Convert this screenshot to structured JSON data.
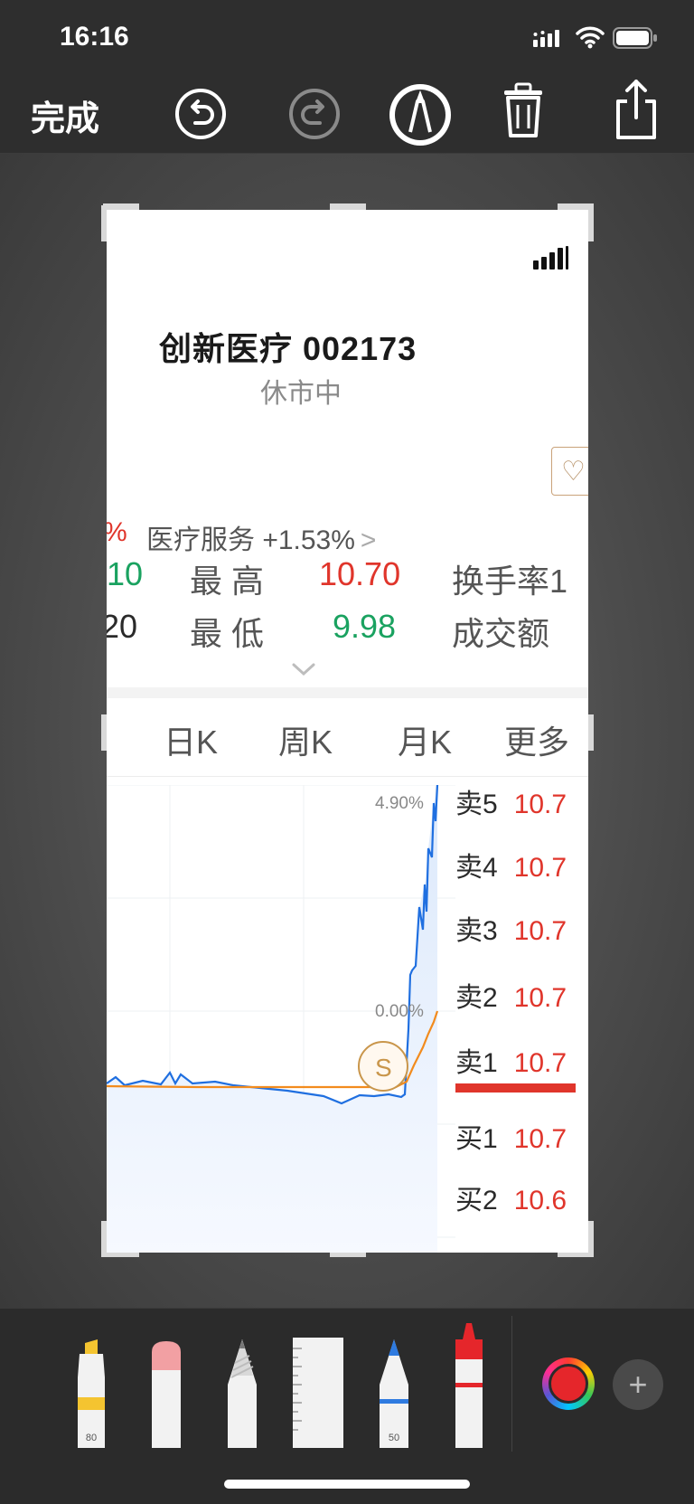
{
  "status_bar": {
    "time": "16:16"
  },
  "toolbar": {
    "done_label": "完成",
    "undo_icon": "undo-icon",
    "redo_icon": "redo-icon",
    "markup_icon": "markup-pen-icon",
    "delete_icon": "trash-icon",
    "share_icon": "share-icon"
  },
  "screenshot": {
    "stock_name_code": "创新医疗  002173",
    "market_status": "休市中",
    "change_fragment": "%",
    "sector": "医疗服务 +1.53%",
    "sector_chevron": ">",
    "quote": {
      "left_val_1": "10",
      "left_val_2": "20",
      "high_label": "最  高",
      "high_value": "10.70",
      "low_label": "最  低",
      "low_value": "9.98",
      "turnover_label": "换手率",
      "turnover_frag": "1",
      "amount_label": "成交额"
    },
    "tabs": [
      "日K",
      "周K",
      "月K",
      "更多"
    ],
    "chart_labels": {
      "top_pct": "4.90%",
      "mid_pct": "0.00%",
      "marker": "S"
    },
    "order_book": {
      "rows": [
        {
          "label": "卖5",
          "price": "10.7"
        },
        {
          "label": "卖4",
          "price": "10.7"
        },
        {
          "label": "卖3",
          "price": "10.7"
        },
        {
          "label": "卖2",
          "price": "10.7"
        },
        {
          "label": "卖1",
          "price": "10.7"
        },
        {
          "label": "买1",
          "price": "10.7"
        },
        {
          "label": "买2",
          "price": "10.6"
        }
      ]
    }
  },
  "tray": {
    "tools": [
      {
        "name": "highlighter",
        "badge": "80"
      },
      {
        "name": "eraser",
        "badge": ""
      },
      {
        "name": "pencil",
        "badge": ""
      },
      {
        "name": "ruler",
        "badge": ""
      },
      {
        "name": "pen",
        "badge": "50"
      },
      {
        "name": "crayon",
        "badge": ""
      }
    ],
    "add_symbol": "+",
    "selected_color": "#e5262b"
  }
}
